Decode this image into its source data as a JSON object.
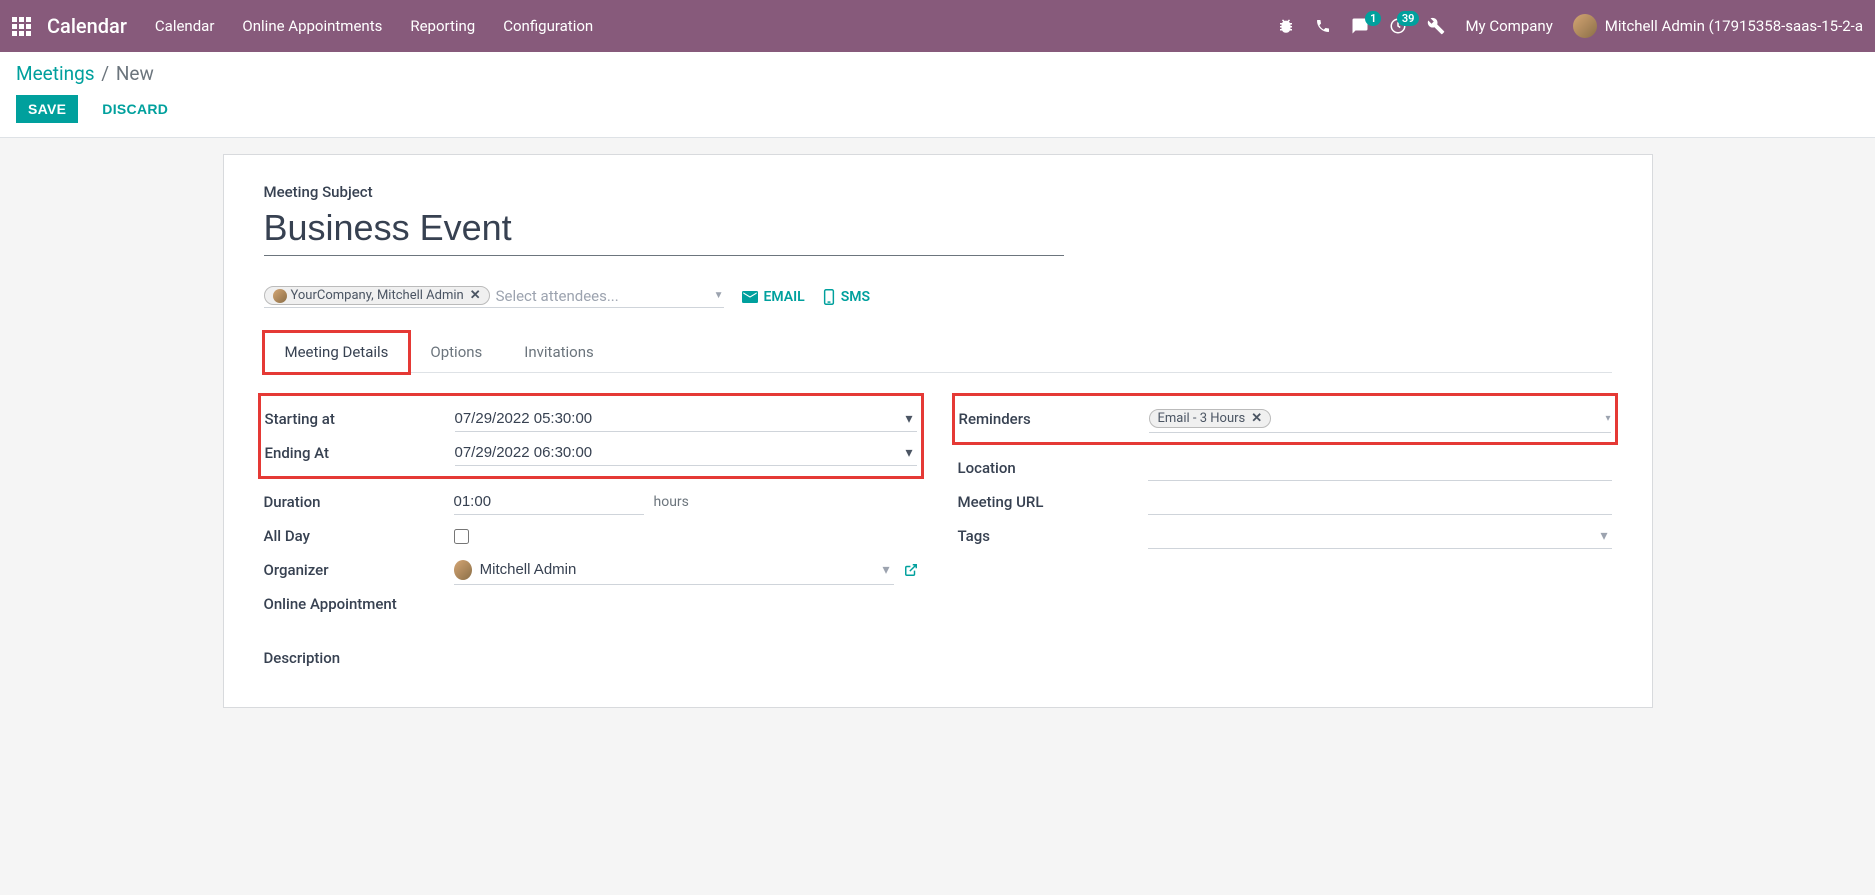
{
  "nav": {
    "brand": "Calendar",
    "menu": [
      "Calendar",
      "Online Appointments",
      "Reporting",
      "Configuration"
    ],
    "chat_badge": "1",
    "activity_badge": "39",
    "company": "My Company",
    "user": "Mitchell Admin (17915358-saas-15-2-a"
  },
  "cp": {
    "bc_root": "Meetings",
    "bc_cur": "New",
    "save": "Save",
    "discard": "Discard"
  },
  "form": {
    "subject_label": "Meeting Subject",
    "subject_value": "Business Event",
    "attendee_tag": "YourCompany, Mitchell Admin",
    "attendee_ph": "Select attendees...",
    "email_btn": "EMAIL",
    "sms_btn": "SMS"
  },
  "tabs": [
    "Meeting Details",
    "Options",
    "Invitations"
  ],
  "left": {
    "start_lbl": "Starting at",
    "start_val": "07/29/2022 05:30:00",
    "end_lbl": "Ending At",
    "end_val": "07/29/2022 06:30:00",
    "dur_lbl": "Duration",
    "dur_val": "01:00",
    "dur_unit": "hours",
    "allday_lbl": "All Day",
    "org_lbl": "Organizer",
    "org_val": "Mitchell Admin",
    "online_lbl": "Online Appointment",
    "desc_lbl": "Description"
  },
  "right": {
    "rem_lbl": "Reminders",
    "rem_tag": "Email - 3 Hours",
    "loc_lbl": "Location",
    "url_lbl": "Meeting URL",
    "tags_lbl": "Tags"
  }
}
